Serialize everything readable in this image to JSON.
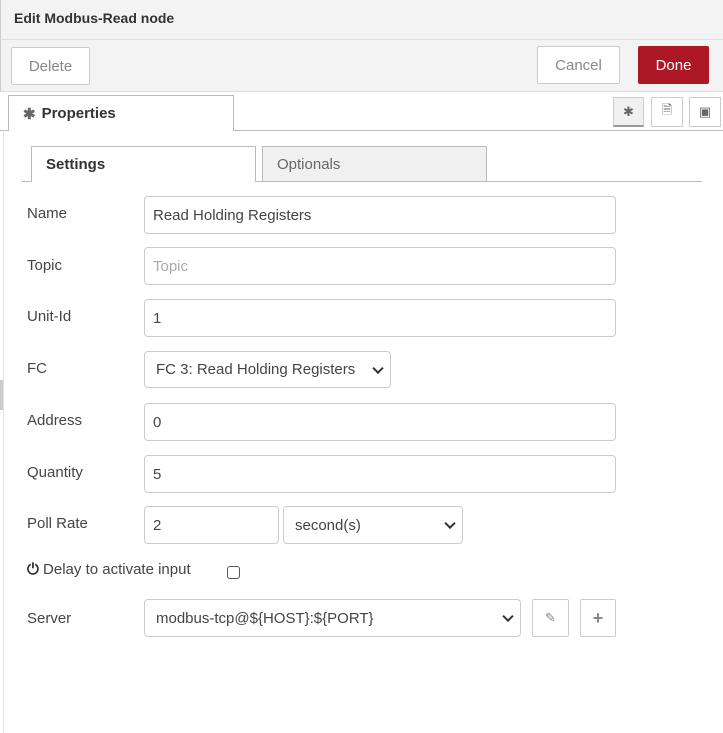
{
  "header": {
    "title": "Edit Modbus-Read node"
  },
  "toolbar": {
    "delete_label": "Delete",
    "cancel_label": "Cancel",
    "done_label": "Done",
    "done_color": "#ad1625"
  },
  "tabs": {
    "properties_label": "Properties",
    "icons": [
      "gear-icon",
      "description-icon",
      "appearance-icon"
    ]
  },
  "subtabs": {
    "settings": "Settings",
    "optionals": "Optionals"
  },
  "form": {
    "name": {
      "label": "Name",
      "value": "Read Holding Registers"
    },
    "topic": {
      "label": "Topic",
      "value": "",
      "placeholder": "Topic"
    },
    "unit_id": {
      "label": "Unit-Id",
      "value": "1"
    },
    "fc": {
      "label": "FC",
      "value": "FC 3: Read Holding Registers"
    },
    "address": {
      "label": "Address",
      "value": "0"
    },
    "quantity": {
      "label": "Quantity",
      "value": "5"
    },
    "poll_rate": {
      "label": "Poll Rate",
      "value": "2",
      "unit": "second(s)"
    },
    "delay": {
      "label": "Delay to activate input",
      "checked": false
    },
    "server": {
      "label": "Server",
      "value": "modbus-tcp@${HOST}:${PORT}"
    }
  }
}
